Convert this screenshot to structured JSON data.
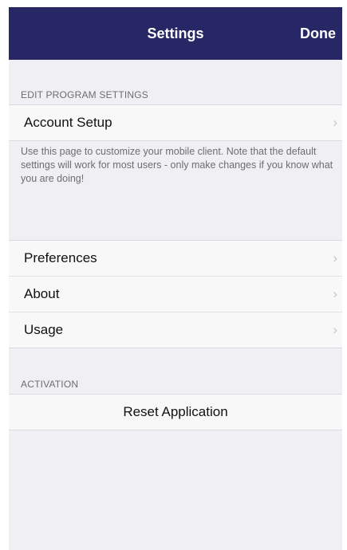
{
  "navbar": {
    "title": "Settings",
    "done_label": "Done",
    "background": "#272766"
  },
  "sections": {
    "edit": {
      "header": "EDIT PROGRAM SETTINGS",
      "account_setup_label": "Account Setup",
      "footnote": "Use this page to customize your mobile client. Note that the default settings will work for most users - only make changes if you know what you are doing!"
    },
    "options": {
      "items": [
        {
          "label": "Preferences"
        },
        {
          "label": "About"
        },
        {
          "label": "Usage"
        }
      ]
    },
    "activation": {
      "header": "ACTIVATION",
      "reset_label": "Reset Application"
    }
  },
  "icons": {
    "chevron": "chevron-right-icon"
  }
}
